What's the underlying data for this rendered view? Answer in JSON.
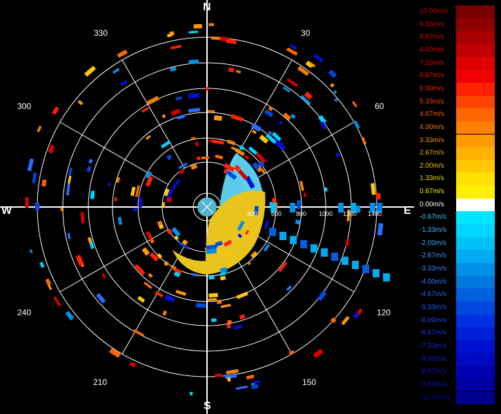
{
  "compass": {
    "north": "N",
    "east": "E",
    "south": "S",
    "west": "W"
  },
  "azimuth_labels": [
    "30",
    "60",
    "120",
    "150",
    "210",
    "240",
    "300",
    "330"
  ],
  "range_labels": [
    "400",
    "600",
    "800",
    "1000",
    "1200",
    "1400"
  ],
  "legend": {
    "items": [
      {
        "label": "10.00m/s",
        "color": "#7a0000",
        "text_color": "#c00000"
      },
      {
        "label": "9.33m/s",
        "color": "#8f0000",
        "text_color": "#c80000"
      },
      {
        "label": "8.67m/s",
        "color": "#a80000",
        "text_color": "#d00000"
      },
      {
        "label": "8.00m/s",
        "color": "#c00000",
        "text_color": "#d80000"
      },
      {
        "label": "7.33m/s",
        "color": "#dd0000",
        "text_color": "#e00000"
      },
      {
        "label": "6.67m/s",
        "color": "#f00000",
        "text_color": "#e81000"
      },
      {
        "label": "6.00m/s",
        "color": "#ff2000",
        "text_color": "#f02000"
      },
      {
        "label": "5.33m/s",
        "color": "#ff4400",
        "text_color": "#f04000"
      },
      {
        "label": "4.67m/s",
        "color": "#ff6600",
        "text_color": "#f06000"
      },
      {
        "label": "4.00m/s",
        "color": "#ff8000",
        "text_color": "#f08000"
      },
      {
        "label": "3.33m/s",
        "color": "#ff9900",
        "text_color": "#f09000"
      },
      {
        "label": "2.67m/s",
        "color": "#ffb000",
        "text_color": "#f0a800"
      },
      {
        "label": "2.00m/s",
        "color": "#ffc800",
        "text_color": "#f0c000"
      },
      {
        "label": "1.33m/s",
        "color": "#ffe000",
        "text_color": "#f0d800"
      },
      {
        "label": "0.67m/s",
        "color": "#fff000",
        "text_color": "#f0f000"
      },
      {
        "label": "0.00m/s",
        "color": "#ffffff",
        "text_color": "#ffffff"
      },
      {
        "label": "-0.67m/s",
        "color": "#00e5ff",
        "text_color": "#40c8ff"
      },
      {
        "label": "-1.33m/s",
        "color": "#00d4ff",
        "text_color": "#40b8ff"
      },
      {
        "label": "-2.00m/s",
        "color": "#00c0f8",
        "text_color": "#40a8ff"
      },
      {
        "label": "-2.67m/s",
        "color": "#00aaf0",
        "text_color": "#3a98ff"
      },
      {
        "label": "-3.33m/s",
        "color": "#0090e8",
        "text_color": "#3488ff"
      },
      {
        "label": "-4.00m/s",
        "color": "#0078e0",
        "text_color": "#2e78ff"
      },
      {
        "label": "-4.67m/s",
        "color": "#0060e0",
        "text_color": "#2868ff"
      },
      {
        "label": "-5.33m/s",
        "color": "#0048e0",
        "text_color": "#2258f8"
      },
      {
        "label": "-6.00m/s",
        "color": "#0030e0",
        "text_color": "#1c48f0"
      },
      {
        "label": "-6.67m/s",
        "color": "#0020d8",
        "text_color": "#1638e8"
      },
      {
        "label": "-7.33m/s",
        "color": "#0010d0",
        "text_color": "#1028e0"
      },
      {
        "label": "-8.00m/s",
        "color": "#0008c0",
        "text_color": "#0a20d0"
      },
      {
        "label": "-8.67m/s",
        "color": "#0000b0",
        "text_color": "#0818c0"
      },
      {
        "label": "-9.33m/s",
        "color": "#0000a0",
        "text_color": "#0610b0"
      },
      {
        "label": "-10.00m/s",
        "color": "#000090",
        "text_color": "#0408a0"
      }
    ]
  }
}
